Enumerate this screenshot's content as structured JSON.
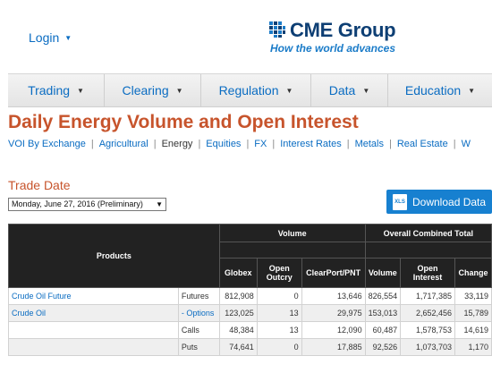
{
  "header": {
    "login_label": "Login",
    "logo_name": "CME Group",
    "logo_tagline": "How the world advances"
  },
  "nav": [
    {
      "label": "Trading"
    },
    {
      "label": "Clearing"
    },
    {
      "label": "Regulation"
    },
    {
      "label": "Data"
    },
    {
      "label": "Education"
    }
  ],
  "page_title": "Daily Energy Volume and Open Interest",
  "sub_nav": [
    "VOI By Exchange",
    "Agricultural",
    "Energy",
    "Equities",
    "FX",
    "Interest Rates",
    "Metals",
    "Real Estate",
    "W"
  ],
  "sub_nav_active": "Energy",
  "trade_date": {
    "label": "Trade Date",
    "selected": "Monday, June 27, 2016 (Preliminary)"
  },
  "download_label": "Download Data",
  "download_icon": "xls-file-icon",
  "table": {
    "group_headers": {
      "products": "Products",
      "volume": "Volume",
      "open_interest": "Overall Combined Total"
    },
    "columns": [
      "Globex",
      "Open Outcry",
      "ClearPort/PNT",
      "Volume",
      "Open Interest",
      "Change"
    ],
    "rows": [
      {
        "product": "Crude Oil Future",
        "product_is_link": true,
        "type": "Futures",
        "type_is_link": false,
        "globex": "812,908",
        "open_outcry": "0",
        "clearport": "13,646",
        "volume": "826,554",
        "open_interest": "1,717,385",
        "change": "33,119"
      },
      {
        "product": "Crude Oil",
        "product_is_link": true,
        "type": "- Options",
        "type_is_link": true,
        "globex": "123,025",
        "open_outcry": "13",
        "clearport": "29,975",
        "volume": "153,013",
        "open_interest": "2,652,456",
        "change": "15,789"
      },
      {
        "product": "",
        "product_is_link": false,
        "type": "Calls",
        "type_is_link": false,
        "globex": "48,384",
        "open_outcry": "13",
        "clearport": "12,090",
        "volume": "60,487",
        "open_interest": "1,578,753",
        "change": "14,619"
      },
      {
        "product": "",
        "product_is_link": false,
        "type": "Puts",
        "type_is_link": false,
        "globex": "74,641",
        "open_outcry": "0",
        "clearport": "17,885",
        "volume": "92,526",
        "open_interest": "1,073,703",
        "change": "1,170"
      }
    ]
  },
  "colors": {
    "accent": "#c7542c",
    "link": "#0a6cc2",
    "button": "#1780d0",
    "header_bg": "#222222"
  }
}
